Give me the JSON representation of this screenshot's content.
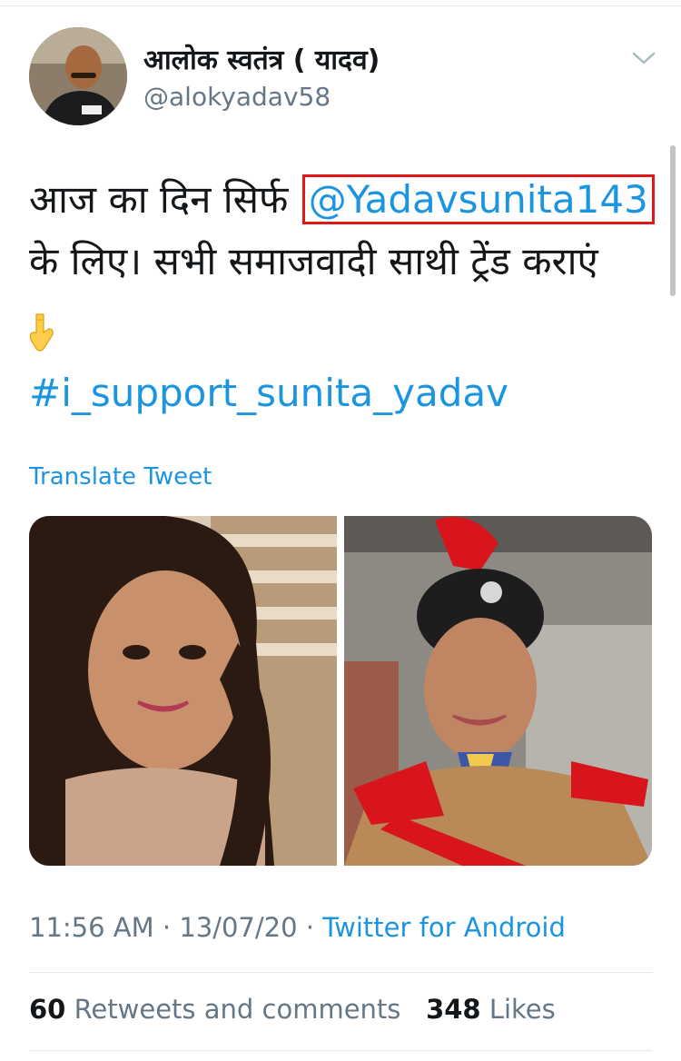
{
  "author": {
    "name": "आलोक स्वतंत्र ( यादव)",
    "handle": "@alokyadav58"
  },
  "tweet": {
    "text_before": "आज का दिन सिर्फ",
    "mention": "@Yadavsunita143",
    "text_after": "के लिए। सभी समाजवादी साथी ट्रेंड कराएं",
    "emoji": "backhand-index-pointing-down",
    "hashtag": "#i_support_sunita_yadav",
    "translate_label": "Translate Tweet"
  },
  "meta": {
    "time": "11:56 AM",
    "separator1": " · ",
    "date": "13/07/20",
    "separator2": " · ",
    "source": "Twitter for Android"
  },
  "stats": {
    "retweets_count": "60",
    "retweets_label": "Retweets and comments",
    "likes_count": "348",
    "likes_label": "Likes"
  },
  "colors": {
    "link": "#1b95e0",
    "highlight_box": "#e3161a",
    "muted": "#657786"
  }
}
